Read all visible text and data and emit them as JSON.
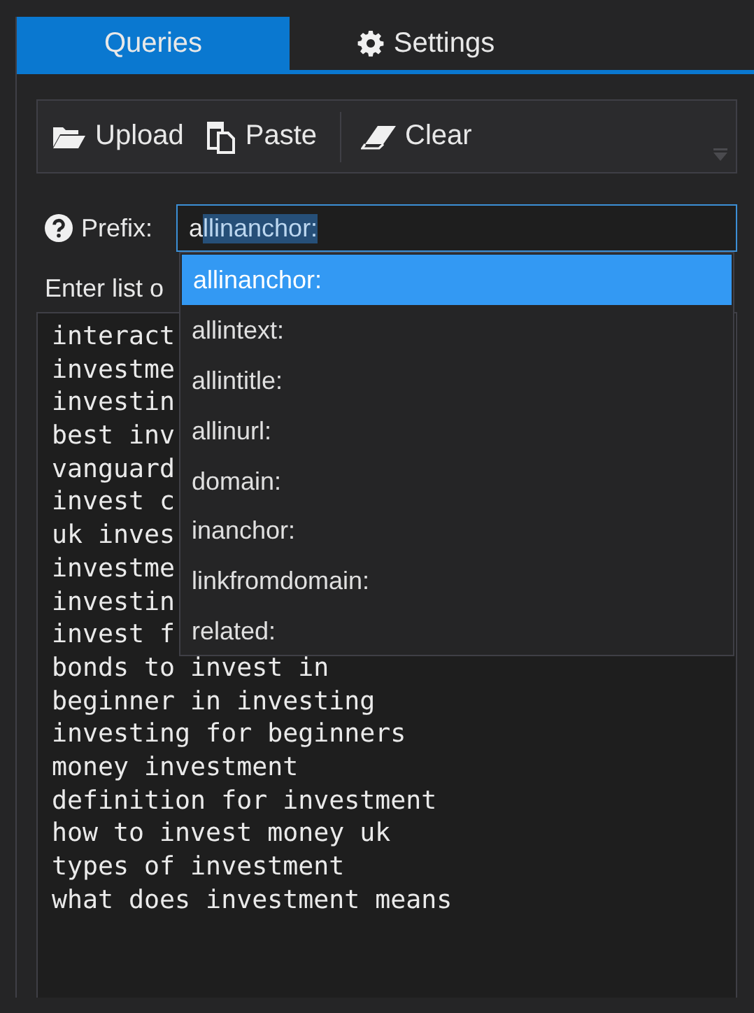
{
  "tabs": [
    {
      "label": "Queries",
      "selected": true
    },
    {
      "label": "Settings",
      "selected": false
    }
  ],
  "toolbar": {
    "buttons": [
      {
        "label": "Upload"
      },
      {
        "label": "Paste"
      },
      {
        "label": "Clear"
      }
    ]
  },
  "prefix": {
    "label": "Prefix:",
    "typed": "a",
    "suggested": "llinanchor:"
  },
  "list_label": "Enter list o",
  "queries": [
    "interact",
    "investme",
    "investin",
    "best inv",
    "vanguard",
    "invest c",
    "uk inves",
    "investme",
    "investin",
    "invest f",
    "bonds to invest in",
    "beginner in investing",
    "investing for beginners",
    "money investment",
    "definition for investment",
    "how to invest money uk",
    "types of investment",
    "what does investment means"
  ],
  "dropdown": [
    {
      "label": "allinanchor:",
      "selected": true
    },
    {
      "label": "allintext:",
      "selected": false
    },
    {
      "label": "allintitle:",
      "selected": false
    },
    {
      "label": "allinurl:",
      "selected": false
    },
    {
      "label": "domain:",
      "selected": false
    },
    {
      "label": "inanchor:",
      "selected": false
    },
    {
      "label": "linkfromdomain:",
      "selected": false
    },
    {
      "label": "related:",
      "selected": false
    }
  ]
}
